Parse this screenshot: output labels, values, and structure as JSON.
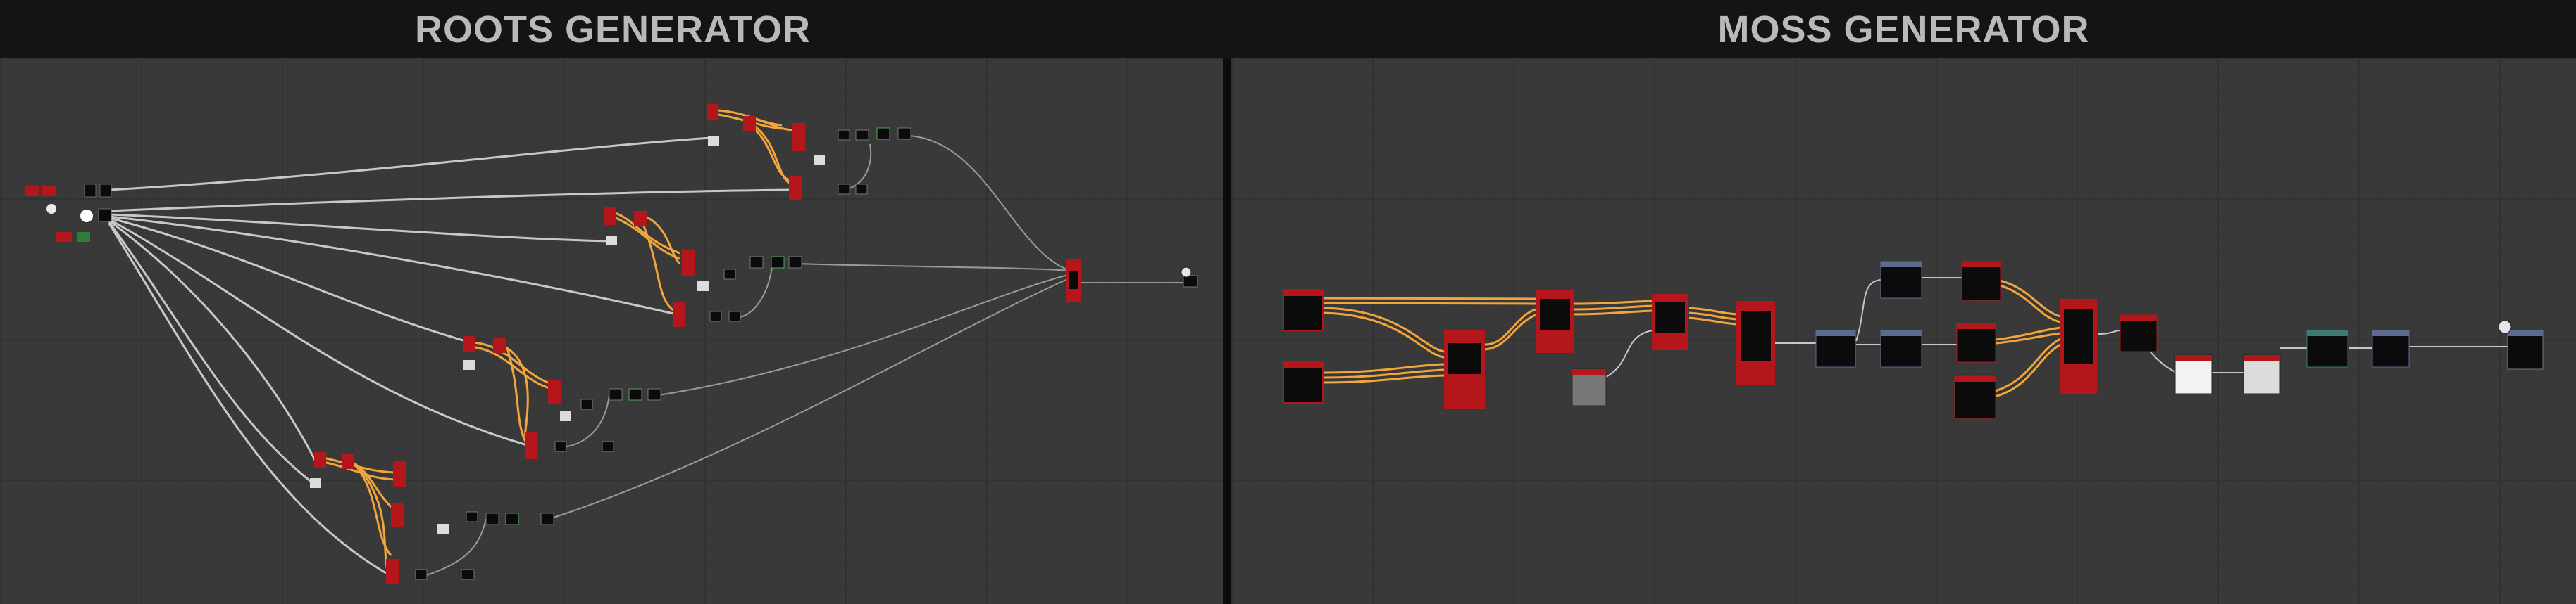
{
  "headers": {
    "left_title": "ROOTS GENERATOR",
    "right_title": "MOSS GENERATOR"
  },
  "colors": {
    "background": "#393939",
    "header": "#141414",
    "title_text": "#b9b9b9",
    "wire_white": "#d8d8d8",
    "wire_gray": "#9a9a9a",
    "wire_orange": "#f2a53a",
    "node_red": "#b5161c",
    "node_black": "#0b0b0b",
    "node_blue_header": "#5b6a8e",
    "node_teal_header": "#3f7a72"
  },
  "icons": {
    "output_node": "output-icon",
    "bitmap_input": "bitmap-icon"
  }
}
